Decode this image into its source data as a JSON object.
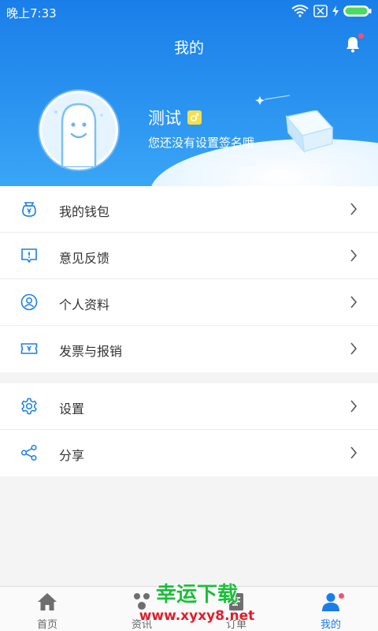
{
  "status_bar": {
    "time": "晚上7:33"
  },
  "header": {
    "title": "我的"
  },
  "profile": {
    "name": "测试",
    "signature": "您还没有设置签名哦"
  },
  "menu_group_1": [
    {
      "label": "我的钱包",
      "icon": "wallet-icon"
    },
    {
      "label": "意见反馈",
      "icon": "feedback-icon"
    },
    {
      "label": "个人资料",
      "icon": "profile-icon"
    },
    {
      "label": "发票与报销",
      "icon": "invoice-icon"
    }
  ],
  "menu_group_2": [
    {
      "label": "设置",
      "icon": "gear-icon"
    },
    {
      "label": "分享",
      "icon": "share-icon"
    }
  ],
  "tabs": [
    {
      "label": "首页",
      "icon": "home-icon"
    },
    {
      "label": "资讯",
      "icon": "news-icon"
    },
    {
      "label": "订单",
      "icon": "orders-icon"
    },
    {
      "label": "我的",
      "icon": "user-icon",
      "active": true
    }
  ],
  "watermark": {
    "title": "幸运下载",
    "url": "www.xyxy8.net"
  },
  "colors": {
    "accent": "#1a7ee9",
    "badge": "#f5e04a",
    "dot": "#ff4d6d"
  }
}
